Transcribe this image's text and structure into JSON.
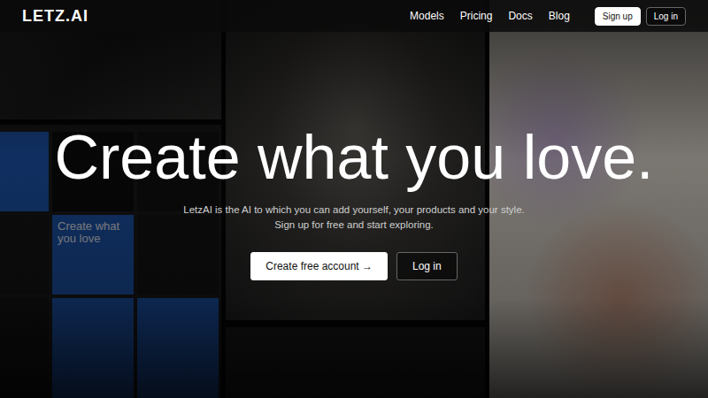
{
  "logo": "LETZ.AI",
  "nav": {
    "links": [
      "Models",
      "Pricing",
      "Docs",
      "Blog"
    ],
    "buttons": [
      {
        "label": "Sign up",
        "kind": "primary"
      },
      {
        "label": "Log in",
        "kind": "outline"
      }
    ]
  },
  "hero": {
    "title": "Create what you love.",
    "subtitle": [
      "LetzAI is the AI to which you can add yourself, your products and your style.",
      "Sign up for free and start exploring."
    ],
    "buttons": [
      {
        "label": "Create free account →",
        "kind": "primary"
      },
      {
        "label": "Log in",
        "kind": "outline"
      }
    ]
  },
  "collage": {
    "screenshot_tiles": [
      {
        "color": "#1d56b0",
        "text": ""
      },
      {
        "color": "#0c0c0c",
        "text": ""
      },
      {
        "color": "#111111",
        "text": ""
      },
      {
        "color": "#161616",
        "text": ""
      },
      {
        "color": "#1d56b0",
        "text": "Create what you love"
      },
      {
        "color": "#141414",
        "text": ""
      },
      {
        "color": "#141414",
        "text": ""
      },
      {
        "color": "#1d56b0",
        "text": ""
      },
      {
        "color": "#1d56b0",
        "text": ""
      }
    ]
  }
}
